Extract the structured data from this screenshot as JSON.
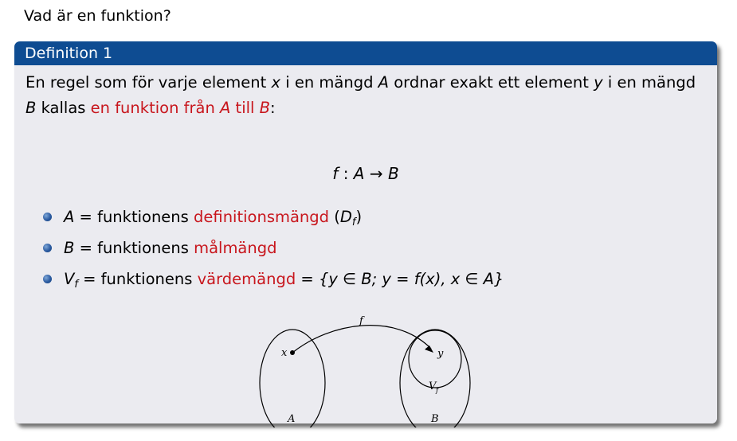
{
  "frame": {
    "title": "Vad är en funktion?"
  },
  "definition": {
    "title": "Definition 1",
    "text_1": "En regel som för varje element ",
    "x": "x",
    "text_2": " i en mängd ",
    "A": "A",
    "text_3": " ordnar exakt ett element ",
    "y": "y",
    "text_4": " i en mängd ",
    "B": "B",
    "text_5": " kallas ",
    "alert_1": "en funktion från ",
    "alert_A": "A",
    "alert_2": " till ",
    "alert_B": "B",
    "text_6": ":"
  },
  "formula": {
    "f": "f",
    "colon": " : ",
    "A": "A",
    "arrow": " → ",
    "B": "B"
  },
  "bullets": [
    {
      "lhs": "A",
      "eq": " = funktionens ",
      "term": "definitionsmängd",
      "rest_open": " (",
      "sym": "D",
      "sub": "f",
      "rest_close": ")"
    },
    {
      "lhs": "B",
      "eq": " = funktionens ",
      "term": "målmängd"
    },
    {
      "lhs": "V",
      "sub": "f",
      "eq": " = funktionens ",
      "term": "värdemängd",
      "set": " = {y ∈ B;  y = f(x),  x ∈ A}"
    }
  ],
  "diagram": {
    "f_label": "f",
    "x_label": "x",
    "y_label": "y",
    "A_label": "A",
    "B_label": "B",
    "V_label": "V",
    "V_sub": "f"
  },
  "colors": {
    "header": "#0e4c92",
    "body_bg": "#ebebf0",
    "alert": "#c8161d"
  }
}
